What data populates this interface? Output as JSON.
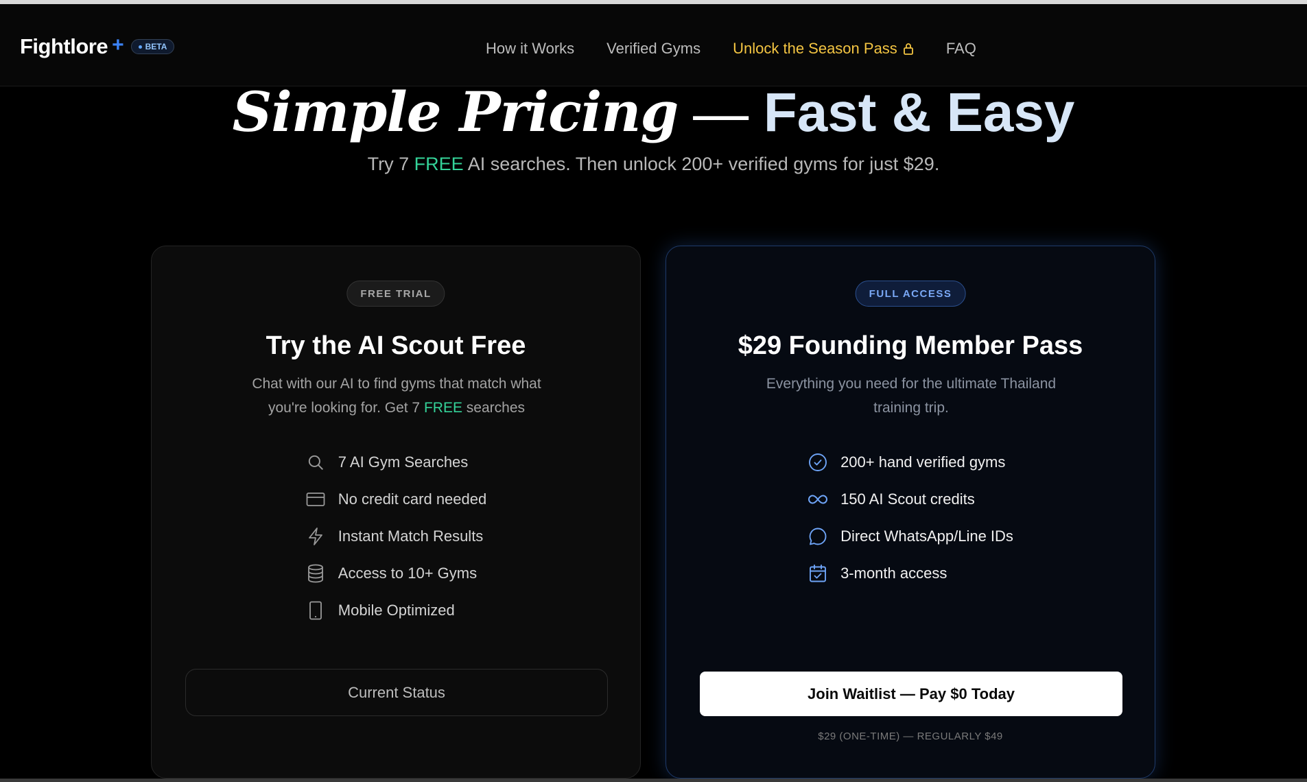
{
  "nav": {
    "logo": "Fightlore",
    "logo_plus": "+",
    "beta": "BETA",
    "links": [
      {
        "label": "How it Works"
      },
      {
        "label": "Verified Gyms"
      },
      {
        "label": "Unlock the Season Pass",
        "accent_color": "#f4c542",
        "icon": "lock-icon"
      },
      {
        "label": "FAQ"
      }
    ]
  },
  "hero": {
    "title_serif": "Simple Pricing",
    "title_dash": "—",
    "title_bold": "Fast & Easy",
    "subtitle_before": "Try 7 ",
    "subtitle_free": "FREE",
    "subtitle_after": " AI searches. Then unlock 200+ verified gyms for just $29."
  },
  "free_card": {
    "badge": "FREE TRIAL",
    "title": "Try the AI Scout Free",
    "desc_before": "Chat with our AI to find gyms that match what you're looking for. Get 7 ",
    "desc_free": "FREE",
    "desc_after": " searches",
    "features": [
      {
        "icon": "search-icon",
        "label": "7 AI Gym Searches"
      },
      {
        "icon": "credit-card-icon",
        "label": "No credit card needed"
      },
      {
        "icon": "lightning-icon",
        "label": "Instant Match Results"
      },
      {
        "icon": "database-icon",
        "label": "Access to 10+ Gyms"
      },
      {
        "icon": "mobile-icon",
        "label": "Mobile Optimized"
      }
    ],
    "button": "Current Status"
  },
  "full_card": {
    "badge": "FULL ACCESS",
    "title": "$29 Founding Member Pass",
    "desc": "Everything you need for the ultimate Thailand training trip.",
    "features": [
      {
        "icon": "check-circle-icon",
        "label": "200+ hand verified gyms"
      },
      {
        "icon": "infinity-icon",
        "label": "150 AI Scout credits"
      },
      {
        "icon": "chat-bubble-icon",
        "label": "Direct WhatsApp/Line IDs"
      },
      {
        "icon": "calendar-check-icon",
        "label": "3-month access"
      }
    ],
    "button": "Join Waitlist — Pay $0 Today",
    "price_note": "$29 (ONE-TIME) — REGULARLY $49"
  },
  "colors": {
    "accent_blue": "#3b82f6",
    "free_green": "#34d399",
    "season_pass_gold": "#f4c542"
  }
}
